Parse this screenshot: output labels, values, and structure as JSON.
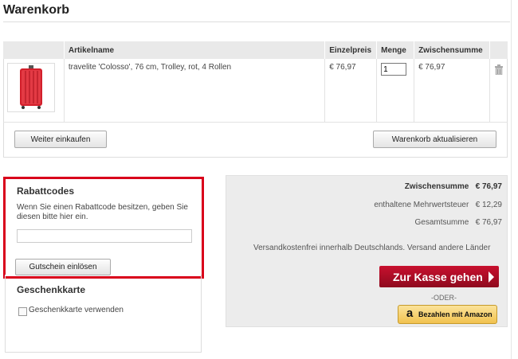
{
  "page": {
    "title": "Warenkorb"
  },
  "cart": {
    "columns": [
      "",
      "Artikelname",
      "Einzelpreis",
      "Menge",
      "Zwischensumme",
      ""
    ],
    "items": [
      {
        "name": "travelite 'Colosso', 76 cm, Trolley, rot, 4 Rollen",
        "price": "€ 76,97",
        "quantity": "1",
        "subtotal": "€ 76,97",
        "image": "red-suitcase",
        "delete_icon": "trash-icon"
      }
    ],
    "continue_label": "Weiter einkaufen",
    "update_label": "Warenkorb aktualisieren"
  },
  "coupon": {
    "title": "Rabattcodes",
    "text": "Wenn Sie einen Rabattcode besitzen, geben Sie diesen bitte hier ein.",
    "input_value": "",
    "button_label": "Gutschein einlösen"
  },
  "giftcard": {
    "title": "Geschenkkarte",
    "checkbox_label": "Geschenkkarte verwenden"
  },
  "totals": {
    "subtotal_label": "Zwischensumme",
    "subtotal_value": "€ 76,97",
    "vat_label": "enthaltene Mehrwertsteuer",
    "vat_value": "€ 12,29",
    "grand_label": "Gesamtsumme",
    "grand_value": "€ 76,97",
    "shipping_text": "Versandkostenfrei innerhalb Deutschlands. Versand andere Länder",
    "checkout_label": "Zur Kasse gehen",
    "or_label": "-ODER-",
    "amazon_label": "Bezahlen mit Amazon"
  },
  "colors": {
    "accent": "#d9001b",
    "checkout": "#b00d25",
    "amazon": "#f6d06a"
  }
}
